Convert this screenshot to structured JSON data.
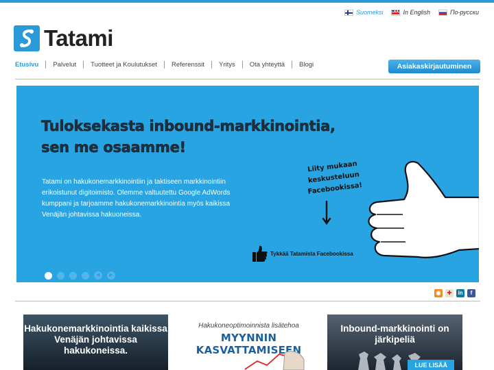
{
  "languages": [
    {
      "label": "Suomeksi",
      "flag": "finland-flag-icon",
      "active": true
    },
    {
      "label": "In English",
      "flag": "uk-flag-icon",
      "active": false
    },
    {
      "label": "По-русски",
      "flag": "russia-flag-icon",
      "active": false
    }
  ],
  "brand": {
    "name": "Tatami",
    "accent": "#2a9ad8"
  },
  "nav": {
    "items": [
      "Etusivu",
      "Palvelut",
      "Tuotteet ja Koulutukset",
      "Referenssit",
      "Yritys",
      "Ota yhteyttä",
      "Blogi"
    ]
  },
  "login_button": "Asiakaskirjautuminen",
  "hero": {
    "title_line1": "Tuloksekasta inbound-markkinointia,",
    "title_line2": "sen me osaamme!",
    "body": "Tatami on hakukonemarkkinointiin ja taktiseen markkinointiin erikoistunut digitoimisto. Olemme valtuutettu Google AdWords kumppani ja tarjoamme hakukonemarkkinointia myös kaikissa Venäjän johtavissa hakuoneissa.",
    "handwritten": "Liity mukaan keskusteluun Facebookissa!",
    "fb_like": "Tykkää Tatamista Facebookissa",
    "background": "#27a4e1"
  },
  "social_icons": [
    "rss-icon",
    "bookmark-icon",
    "linkedin-icon",
    "facebook-icon"
  ],
  "cards": {
    "card1_title": "Hakukonemarkkinointia kaikissa Venäjän johtavissa hakukoneissa.",
    "card2_sub": "Hakukoneoptimoinnista lisätehoa",
    "card2_big": "MYYNNIN KASVATTAMISEEN",
    "card3_title": "Inbound-markkinointi on järkipeliä",
    "card3_cta": "LUE LISÄÄ"
  }
}
